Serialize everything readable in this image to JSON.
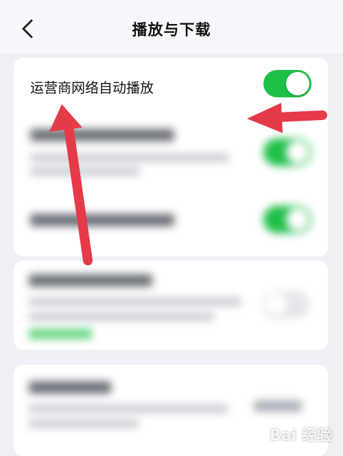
{
  "header": {
    "title": "播放与下载",
    "back_icon": "chevron-left-icon"
  },
  "settings": {
    "carrier_autoplay": {
      "label": "运营商网络自动播放",
      "enabled": true
    }
  },
  "watermark": {
    "text": "Bai 经验"
  },
  "colors": {
    "toggle_on": "#1fbf4a",
    "arrow": "#e53a47",
    "background": "#eef0f5"
  }
}
